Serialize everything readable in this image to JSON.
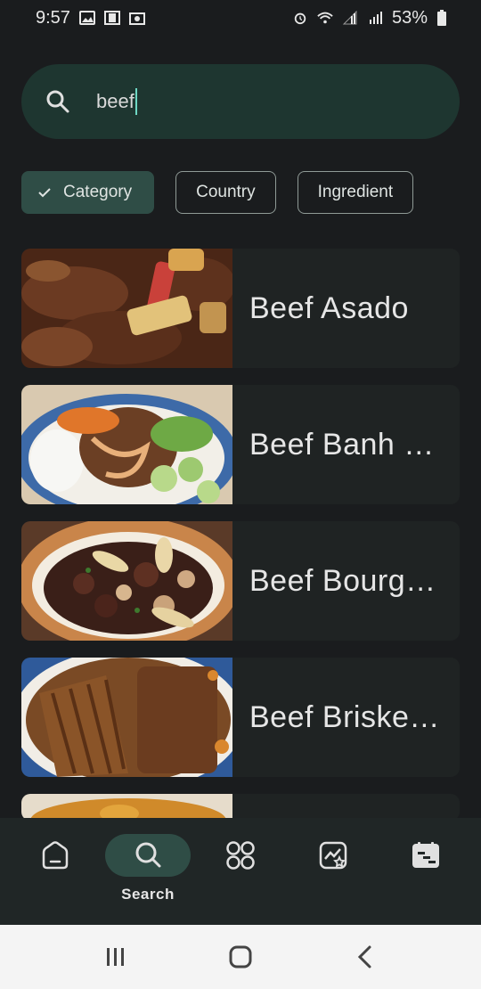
{
  "status_bar": {
    "time": "9:57",
    "battery": "53%",
    "left_icons": [
      "image-icon",
      "film-icon",
      "gallery-icon"
    ],
    "right_icons": [
      "alarm-icon",
      "wifi-icon",
      "signal-icon",
      "signal-icon",
      "battery-icon"
    ]
  },
  "search": {
    "query": "beef",
    "icon": "search-icon"
  },
  "filters": [
    {
      "label": "Category",
      "selected": true
    },
    {
      "label": "Country",
      "selected": false
    },
    {
      "label": "Ingredient",
      "selected": false
    }
  ],
  "results": [
    {
      "title": "Beef Asado"
    },
    {
      "title": "Beef Banh …"
    },
    {
      "title": "Beef Bourg…"
    },
    {
      "title": "Beef Briske…"
    }
  ],
  "bottom_nav": {
    "items": [
      {
        "icon": "home-icon",
        "label": ""
      },
      {
        "icon": "search-icon",
        "label": "Search",
        "active": true
      },
      {
        "icon": "categories-icon",
        "label": ""
      },
      {
        "icon": "favorites-icon",
        "label": ""
      },
      {
        "icon": "planner-icon",
        "label": ""
      }
    ]
  },
  "colors": {
    "background": "#1a1c1e",
    "search_bg": "#1e3630",
    "accent": "#2f4d46",
    "caret": "#6fd8c4"
  }
}
